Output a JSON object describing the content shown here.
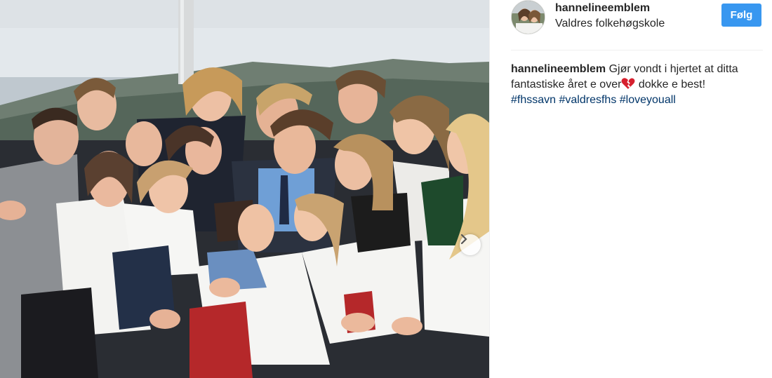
{
  "post": {
    "username": "hannelineemblem",
    "location": "Valdres folkehøgskole",
    "follow_label": "Følg"
  },
  "caption": {
    "username": "hannelineemblem",
    "text_before_emoji": "Gjør vondt i hjertet at ditta fantastiske året e over",
    "emoji": "broken-heart-icon",
    "text_after_emoji": " dokke e best!",
    "hashtags": [
      "#fhssavn",
      "#valdresfhs",
      "#loveyouall"
    ]
  },
  "colors": {
    "follow_button": "#3897f0",
    "hashtag": "#003569",
    "text": "#262626",
    "divider": "#efefef"
  },
  "icons": {
    "carousel_next": "chevron-right-icon"
  }
}
